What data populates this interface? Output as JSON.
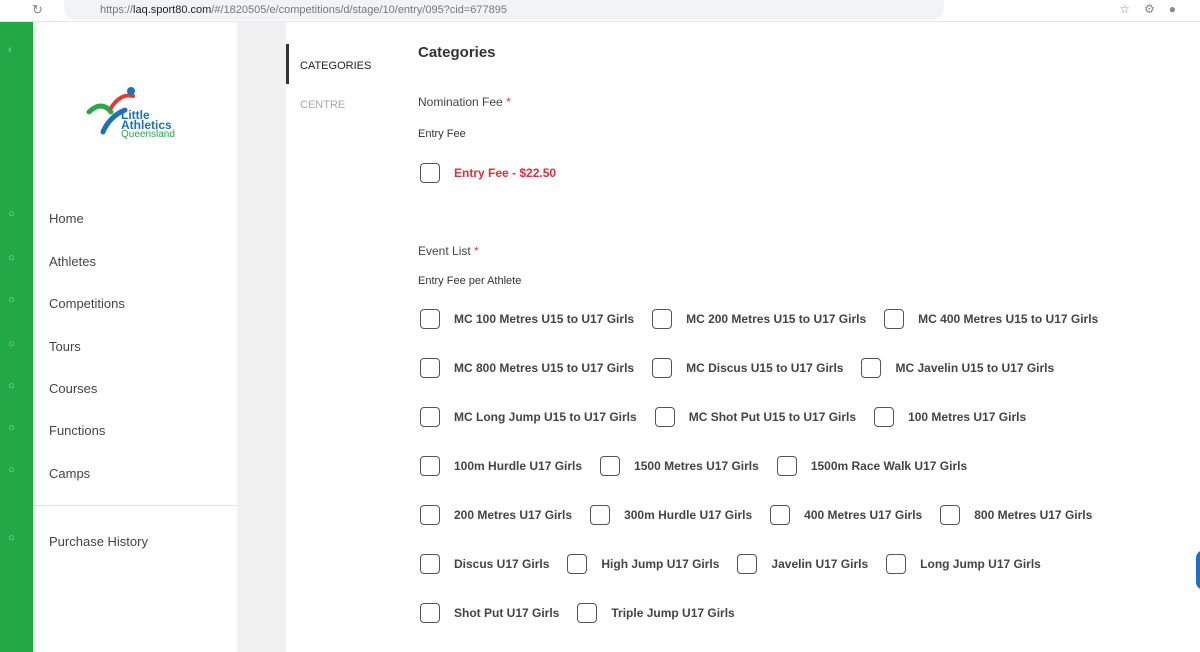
{
  "browser": {
    "url_prefix": "https://",
    "url_domain": "laq.sport80.com",
    "url_rest": "/#/1820505/e/competitions/d/stage/10/entry/095?cid=677895"
  },
  "sidebar": {
    "logo": {
      "line1": "Little",
      "line2": "Athletics",
      "line3": "Queensland"
    },
    "items": [
      {
        "label": "Home"
      },
      {
        "label": "Athletes"
      },
      {
        "label": "Competitions"
      },
      {
        "label": "Tours"
      },
      {
        "label": "Courses"
      },
      {
        "label": "Functions"
      },
      {
        "label": "Camps"
      }
    ],
    "purchase_history": "Purchase History"
  },
  "tabs": [
    {
      "label": "CATEGORIES",
      "active": true
    },
    {
      "label": "CENTRE",
      "active": false
    }
  ],
  "main": {
    "title": "Categories",
    "nomination_label": "Nomination Fee",
    "required_mark": "*",
    "entry_fee_caption": "Entry Fee",
    "entry_fee_option": "Entry Fee - $22.50",
    "event_list_label": "Event List",
    "entry_fee_per_athlete": "Entry Fee per Athlete",
    "events": [
      [
        "MC 100 Metres U15 to U17 Girls",
        "MC 200 Metres U15 to U17 Girls",
        "MC 400 Metres U15 to U17 Girls"
      ],
      [
        "MC 800 Metres U15 to U17 Girls",
        "MC Discus U15 to U17 Girls",
        "MC Javelin U15 to U17 Girls"
      ],
      [
        "MC Long Jump U15 to U17 Girls",
        "MC Shot Put U15 to U17 Girls",
        "100 Metres U17 Girls"
      ],
      [
        "100m Hurdle U17 Girls",
        "1500 Metres U17 Girls",
        "1500m Race Walk U17 Girls"
      ],
      [
        "200 Metres U17 Girls",
        "300m Hurdle U17 Girls",
        "400 Metres U17 Girls",
        "800 Metres U17 Girls"
      ],
      [
        "Discus U17 Girls",
        "High Jump U17 Girls",
        "Javelin U17 Girls",
        "Long Jump U17 Girls"
      ],
      [
        "Shot Put U17 Girls",
        "Triple Jump U17 Girls"
      ]
    ]
  },
  "colors": {
    "brand_green": "#22a845",
    "required_red": "#e53935",
    "fee_red": "#e0303a"
  }
}
